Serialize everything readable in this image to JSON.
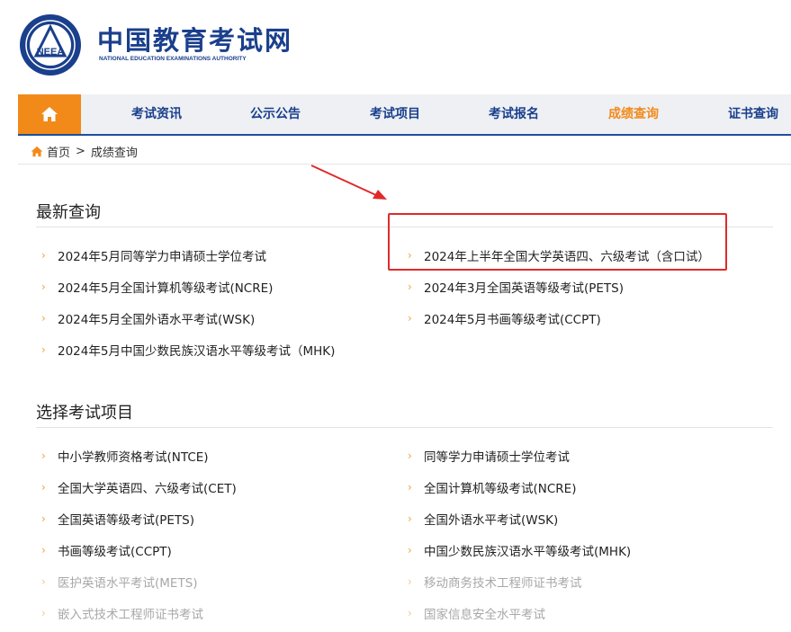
{
  "header": {
    "site_title": "中国教育考试网",
    "site_subtitle": "NATIONAL EDUCATION EXAMINATIONS AUTHORITY",
    "emblem_text": "NEEA",
    "brand_color": "#1a3f8c",
    "accent_color": "#f28a1a"
  },
  "nav": {
    "home_icon": "home-icon",
    "items": [
      {
        "label": "考试资讯"
      },
      {
        "label": "公示公告"
      },
      {
        "label": "考试项目"
      },
      {
        "label": "考试报名"
      },
      {
        "label": "成绩查询",
        "active": true
      },
      {
        "label": "证书查询"
      }
    ]
  },
  "breadcrumb": {
    "icon": "home-icon",
    "home": "首页",
    "separator": ">",
    "current": "成绩查询"
  },
  "latest": {
    "title": "最新查询",
    "items": [
      {
        "label": "2024年5月同等学力申请硕士学位考试"
      },
      {
        "label": "2024年上半年全国大学英语四、六级考试（含口试）",
        "highlighted": true
      },
      {
        "label": "2024年5月全国计算机等级考试(NCRE)"
      },
      {
        "label": "2024年3月全国英语等级考试(PETS)"
      },
      {
        "label": "2024年5月全国外语水平考试(WSK)"
      },
      {
        "label": "2024年5月书画等级考试(CCPT)"
      },
      {
        "label": "2024年5月中国少数民族汉语水平等级考试（MHK)"
      }
    ]
  },
  "projects": {
    "title": "选择考试项目",
    "items": [
      {
        "label": "中小学教师资格考试(NTCE)"
      },
      {
        "label": "同等学力申请硕士学位考试"
      },
      {
        "label": "全国大学英语四、六级考试(CET)"
      },
      {
        "label": "全国计算机等级考试(NCRE)"
      },
      {
        "label": "全国英语等级考试(PETS)"
      },
      {
        "label": "全国外语水平考试(WSK)"
      },
      {
        "label": "书画等级考试(CCPT)"
      },
      {
        "label": "中国少数民族汉语水平等级考试(MHK)"
      },
      {
        "label": "医护英语水平考试(METS)",
        "disabled": true
      },
      {
        "label": "移动商务技术工程师证书考试",
        "disabled": true
      },
      {
        "label": "嵌入式技术工程师证书考试",
        "disabled": true
      },
      {
        "label": "国家信息安全水平考试",
        "disabled": true
      }
    ]
  },
  "annotation": {
    "color": "#e02a2a"
  }
}
